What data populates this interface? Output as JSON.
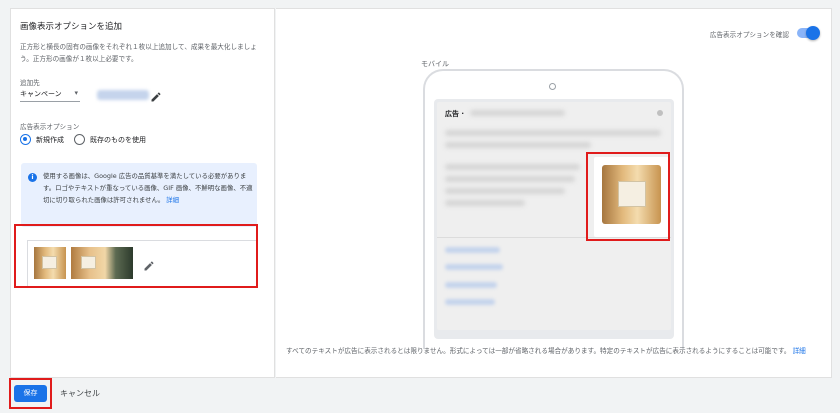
{
  "panel": {
    "title": "画像表示オプションを追加",
    "description": "正方形と横長の固有の画像をそれぞれ１枚以上追加して、成果を最大化しましょう。正方形の画像が１枚以上必要です。",
    "add_to_label": "追加先",
    "campaign_select": "キャンペーン",
    "extension_label": "広告表示オプション",
    "radio_new": "新規作成",
    "radio_existing": "既存のものを使用",
    "info_text": "使用する画像は、Google 広告の品質基準を満たしている必要があります。ロゴやテキストが重なっている画像、GIF 画像、不鮮明な画像、不適切に切り取られた画像は許可されません。",
    "info_link": "詳細"
  },
  "preview": {
    "toggle_label": "広告表示オプションを確認",
    "device_label": "モバイル",
    "ad_label": "広告 ·",
    "notice": "すべてのテキストが広告に表示されるとは限りません。形式によっては一部が省略される場合があります。特定のテキストが広告に表示されるようにすることは可能です。",
    "notice_link": "詳細"
  },
  "footer": {
    "save_label": "保存",
    "cancel_label": "キャンセル"
  },
  "colors": {
    "accent": "#1a73e8",
    "highlight": "#e01b1b"
  }
}
